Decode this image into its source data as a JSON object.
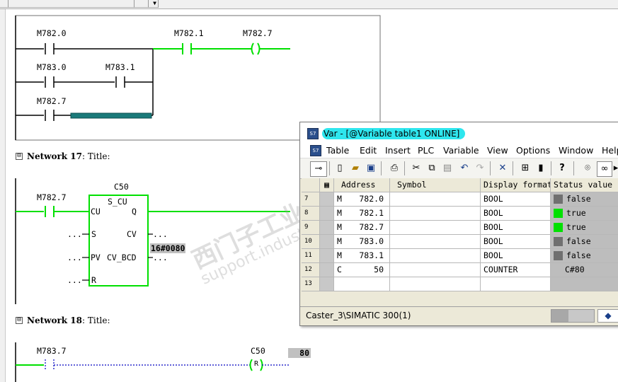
{
  "colors": {
    "rung_green": "#00e000",
    "wire_black": "#000000",
    "status_green": "#00e000",
    "status_gray": "#707070",
    "title_highlight": "#2ee6ee",
    "bar_teal": "#1a7a7a"
  },
  "editor": {
    "network16": {
      "contacts": [
        {
          "label": "M782.0"
        },
        {
          "label": "M782.1"
        },
        {
          "label": "M783.0"
        },
        {
          "label": "M783.1"
        },
        {
          "label": "M782.7"
        }
      ],
      "coil_label": "M782.7",
      "coil_symbol": "( )"
    },
    "network17": {
      "title_prefix": "Network 17",
      "title_suffix": ": Title:",
      "counter_name": "C50",
      "block_type": "S_CU",
      "contact_label": "M782.7",
      "pins": {
        "cu": "CU",
        "s": "S",
        "pv": "PV",
        "r": "R",
        "q": "Q",
        "cv": "CV",
        "cv_bcd": "CV_BCD"
      },
      "input_placeholder": "...",
      "cv_out": "...",
      "cv_bcd_out": "...",
      "cv_value": "16#0080"
    },
    "network18": {
      "title_prefix": "Network 18",
      "title_suffix": ": Title:",
      "contact_label": "M783.7",
      "coil_label": "C50",
      "coil_symbol": "R",
      "counter_value": "80"
    },
    "collapse_symbol": "⊟",
    "watermark_1": "西门子工业",
    "watermark_2": "support.industry."
  },
  "var_window": {
    "title": "Var - [@Variable table1  ONLINE]",
    "app_icon": "S7",
    "menu": [
      "Table",
      "Edit",
      "Insert",
      "PLC",
      "Variable",
      "View",
      "Options",
      "Window",
      "Help"
    ],
    "toolbar_icons": [
      "pin-icon",
      "new-icon",
      "open-icon",
      "save-icon",
      "print-icon",
      "cut-icon",
      "copy-icon",
      "paste-icon",
      "undo-icon",
      "redo-icon",
      "delete-icon",
      "online-icon",
      "monitor-icon",
      "help-icon",
      "glasses-icon",
      "watch-icon"
    ],
    "columns": [
      "Address",
      "Symbol",
      "Display format",
      "Status value"
    ],
    "rows": [
      {
        "num": "7",
        "area": "M",
        "addr": "782.0",
        "symbol": "",
        "format": "BOOL",
        "status": "false",
        "status_color": "#707070"
      },
      {
        "num": "8",
        "area": "M",
        "addr": "782.1",
        "symbol": "",
        "format": "BOOL",
        "status": "true",
        "status_color": "#00e000"
      },
      {
        "num": "9",
        "area": "M",
        "addr": "782.7",
        "symbol": "",
        "format": "BOOL",
        "status": "true",
        "status_color": "#00e000"
      },
      {
        "num": "10",
        "area": "M",
        "addr": "783.0",
        "symbol": "",
        "format": "BOOL",
        "status": "false",
        "status_color": "#707070"
      },
      {
        "num": "11",
        "area": "M",
        "addr": "783.1",
        "symbol": "",
        "format": "BOOL",
        "status": "false",
        "status_color": "#707070"
      },
      {
        "num": "12",
        "area": "C",
        "addr": "50",
        "symbol": "",
        "format": "COUNTER",
        "status": "C#80",
        "status_color": ""
      },
      {
        "num": "13",
        "area": "",
        "addr": "",
        "symbol": "",
        "format": "",
        "status": "",
        "status_color": ""
      }
    ],
    "status_text": "Caster_3\\SIMATIC 300(1)"
  }
}
